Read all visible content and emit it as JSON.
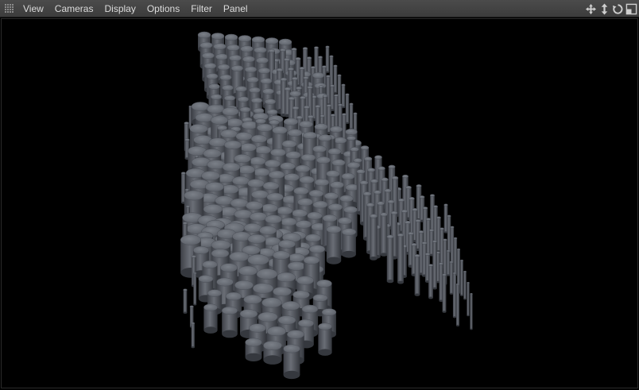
{
  "menubar": {
    "items": [
      "View",
      "Cameras",
      "Display",
      "Options",
      "Filter",
      "Panel"
    ]
  },
  "toolbar": {
    "icons": [
      "move-view-icon",
      "dolly-view-icon",
      "rotate-view-icon",
      "toggle-layout-icon"
    ]
  },
  "viewport": {
    "background": "#000000",
    "cylinder_color": "#666a72"
  }
}
